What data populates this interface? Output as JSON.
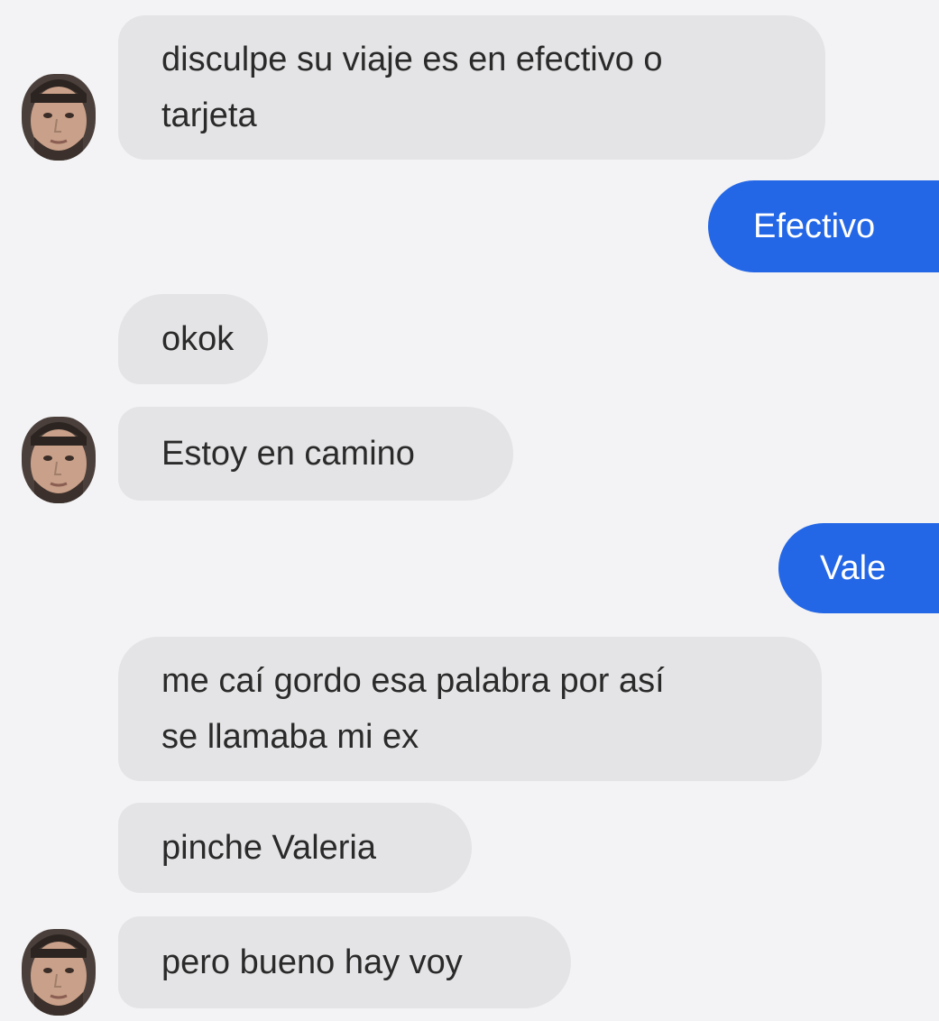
{
  "conversation": {
    "messages": [
      {
        "sender": "driver",
        "text": "disculpe su viaje es en efectivo o tarjeta",
        "lines": [
          "disculpe su viaje es en efectivo o",
          "tarjeta"
        ],
        "has_avatar": true
      },
      {
        "sender": "user",
        "text": "Efectivo"
      },
      {
        "sender": "driver",
        "text": "okok"
      },
      {
        "sender": "driver",
        "text": "Estoy en camino",
        "has_avatar": true
      },
      {
        "sender": "user",
        "text": "Vale"
      },
      {
        "sender": "driver",
        "text": "me caí gordo esa palabra por así se llamaba mi ex",
        "lines": [
          "me caí gordo esa palabra por así",
          "se llamaba mi ex"
        ]
      },
      {
        "sender": "driver",
        "text": "pinche Valeria"
      },
      {
        "sender": "driver",
        "text": "pero bueno hay voy",
        "has_avatar": true
      }
    ]
  },
  "avatar": {
    "icon": "driver-face-icon"
  },
  "colors": {
    "background": "#f3f3f5",
    "incoming_bubble": "#e4e4e6",
    "outgoing_bubble": "#2467e6",
    "incoming_text": "#2a2a2a",
    "outgoing_text": "#ffffff"
  }
}
